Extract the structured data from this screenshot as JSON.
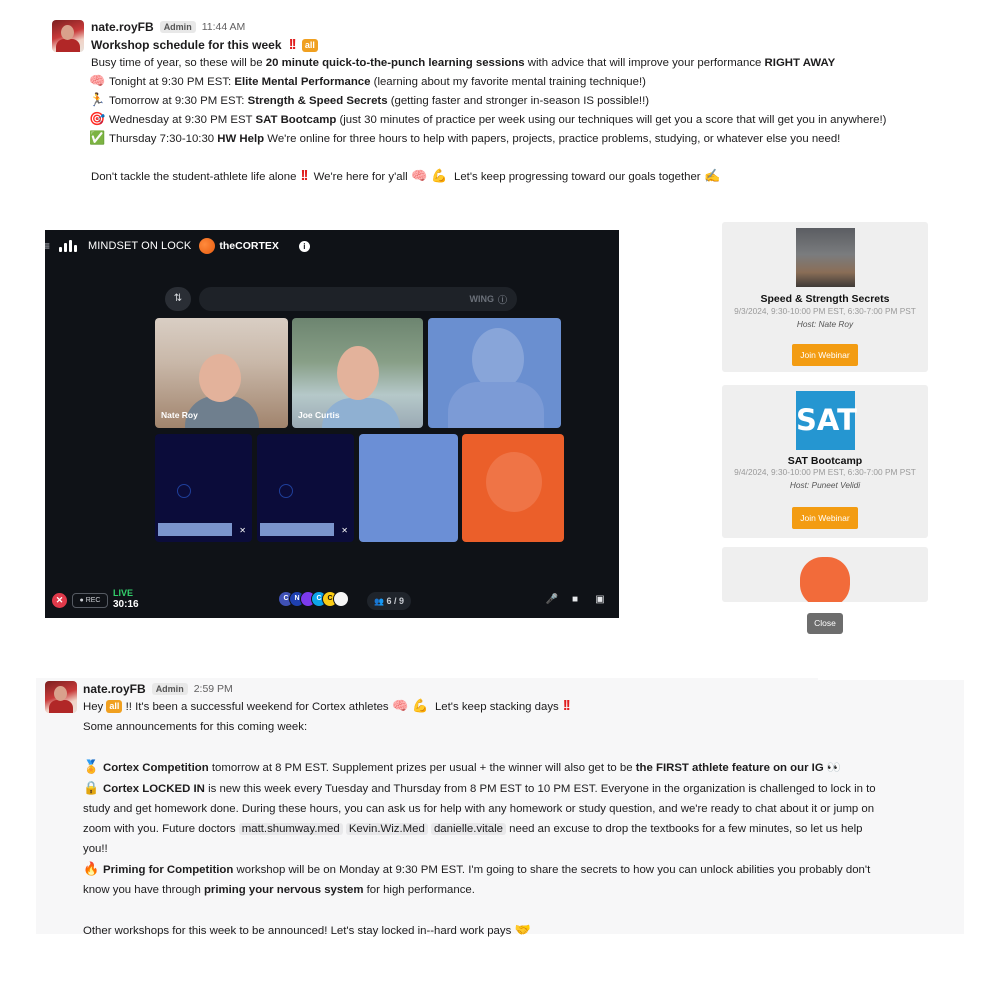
{
  "message1": {
    "username": "nate.royFB",
    "role_badge": "Admin",
    "timestamp": "11:44 AM",
    "title": "Workshop schedule for this week",
    "title_exclaim": "!!",
    "all_tag": "all",
    "intro_pre": "Busy time of year, so these will be ",
    "intro_bold": "20 minute quick-to-the-punch learning sessions",
    "intro_mid": " with advice that will improve your performance ",
    "intro_bold2": "RIGHT AWAY",
    "items": [
      {
        "emoji": "🧠",
        "pre": "Tonight at 9:30 PM EST: ",
        "bold": "Elite Mental Performance",
        "post": " (learning about my favorite mental training technique!)"
      },
      {
        "emoji": "🏃",
        "pre": "Tomorrow at 9:30 PM EST: ",
        "bold": "Strength & Speed Secrets",
        "post": " (getting faster and stronger in-season IS possible!!)"
      },
      {
        "emoji": "🎯",
        "pre": "Wednesday at 9:30 PM EST ",
        "bold": "SAT Bootcamp",
        "post": " (just 30 minutes of practice per week using our techniques will get you a score that will get you in anywhere!)"
      },
      {
        "emoji": "✅",
        "pre": "Thursday 7:30-10:30 ",
        "bold": "HW Help",
        "post": " We're online for three hours to help with papers, projects, practice problems, studying, or whatever else you need!"
      }
    ],
    "closing_1": "Don't tackle the student-athlete life alone",
    "closing_exclaim": "!!",
    "closing_2": " We're here for y'all",
    "closing_emoji_1": "🧠",
    "closing_emoji_2": "💪",
    "closing_3": " Let's keep progressing toward our goals together",
    "closing_emoji_3": "✍"
  },
  "video": {
    "menu_icon": "≡",
    "title": "MINDSET ON LOCK",
    "brand": "theCORTEX",
    "info_icon": "i",
    "filter_icon": "⇅",
    "search_label": "WING",
    "search_icon": "ⓘ",
    "participants": [
      {
        "name": "Nate Roy"
      },
      {
        "name": "Joe Curtis"
      }
    ],
    "end_icon": "✕",
    "rec_label": "● REC",
    "live_label": "LIVE",
    "timer": "30:16",
    "avatar_initials": [
      "C",
      "N",
      "",
      "C",
      "C",
      ""
    ],
    "avatar_colors": [
      "#3f51b5",
      "#1e40af",
      "#7c3aed",
      "#0ea5e9",
      "#facc15",
      "#f5f5f5"
    ],
    "participant_count": "6 / 9",
    "people_icon": "👥",
    "mic_icon": "🎤",
    "camera_icon": "■",
    "screen_icon": "▣"
  },
  "webinars": [
    {
      "title": "Speed & Strength Secrets",
      "time": "9/3/2024, 9:30-10:00 PM EST, 6:30-7:00 PM PST",
      "host": "Host: Nate Roy",
      "button": "Join Webinar"
    },
    {
      "image_text": "SAT",
      "title": "SAT Bootcamp",
      "time": "9/4/2024, 9:30-10:00 PM EST, 6:30-7:00 PM PST",
      "host": "Host: Puneet Velidi",
      "button": "Join Webinar"
    }
  ],
  "close_button": "Close",
  "message2": {
    "username": "nate.royFB",
    "role_badge": "Admin",
    "timestamp": "2:59 PM",
    "line1_pre": "Hey ",
    "all_tag": "all",
    "line1_post": " !! It's been a successful weekend for Cortex athletes",
    "line1_emoji_1": "🧠",
    "line1_emoji_2": "💪",
    "line1_tail": " Let's keep stacking days",
    "line1_exclaim": "!!",
    "line2": "Some announcements for this coming week:",
    "a1_emoji": "🏅",
    "a1_bold": "Cortex Competition",
    "a1_text": " tomorrow at 8 PM EST. Supplement prizes per usual + the winner will also get to be ",
    "a1_bold2": "the FIRST athlete feature on our IG",
    "a1_eyes": "👀",
    "a2_emoji": "🔒",
    "a2_bold": "Cortex LOCKED IN",
    "a2_text_1": " is new this week every Tuesday and Thursday from 8 PM EST to 10 PM EST. Everyone in the organization is challenged to lock in to",
    "a2_text_2": "study and get homework done. During these hours, you can ask us for help with any homework or study question, and we're ready to chat about it or jump on",
    "a2_text_3": "zoom with you. Future doctors ",
    "mentions": [
      "matt.shumway.med",
      "Kevin.Wiz.Med",
      "danielle.vitale"
    ],
    "a2_text_4": " need an excuse to drop the textbooks for a few minutes, so let us help",
    "a2_text_5": "you!!",
    "a3_emoji": "🔥",
    "a3_bold": "Priming for Competition",
    "a3_text_1": " workshop will be on Monday at 9:30 PM EST. I'm going to share the secrets to how you can unlock abilities you probably don't",
    "a3_text_2": "know you have through ",
    "a3_bold2": "priming your nervous system",
    "a3_text_3": " for high performance.",
    "final": "Other workshops for this week to be announced! Let's stay locked in--hard work pays",
    "final_emoji": "🤝"
  }
}
